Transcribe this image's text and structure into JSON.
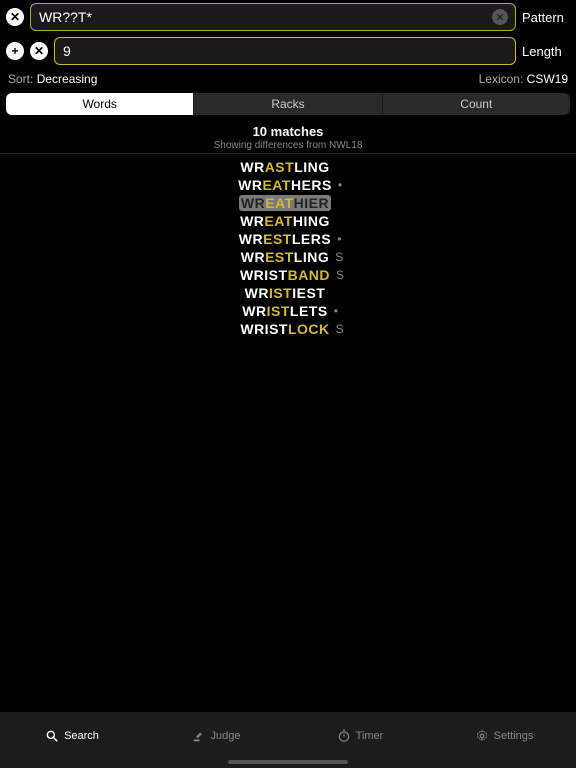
{
  "inputs": {
    "pattern_value": "WR??T*",
    "pattern_label": "Pattern",
    "length_value": "9",
    "length_label": "Length"
  },
  "sort": {
    "label": "Sort:",
    "value": "Decreasing"
  },
  "lexicon": {
    "label": "Lexicon:",
    "value": "CSW19"
  },
  "segments": {
    "words": "Words",
    "racks": "Racks",
    "count": "Count"
  },
  "header": {
    "matches": "10 matches",
    "sub": "Showing differences from NWL18"
  },
  "results": [
    {
      "parts": [
        {
          "t": "WR",
          "c": "w"
        },
        {
          "t": "AST",
          "c": "y"
        },
        {
          "t": "LING",
          "c": "w"
        }
      ],
      "after": "",
      "hl": false
    },
    {
      "parts": [
        {
          "t": "WR",
          "c": "w"
        },
        {
          "t": "EAT",
          "c": "y"
        },
        {
          "t": "HERS",
          "c": "w"
        }
      ],
      "after": "•",
      "hl": false
    },
    {
      "parts": [
        {
          "t": "WR",
          "c": "w"
        },
        {
          "t": "EAT",
          "c": "y"
        },
        {
          "t": "HIER",
          "c": "w"
        }
      ],
      "after": "",
      "hl": true
    },
    {
      "parts": [
        {
          "t": "WR",
          "c": "w"
        },
        {
          "t": "EAT",
          "c": "y"
        },
        {
          "t": "HING",
          "c": "w"
        }
      ],
      "after": "",
      "hl": false
    },
    {
      "parts": [
        {
          "t": "WR",
          "c": "w"
        },
        {
          "t": "EST",
          "c": "y"
        },
        {
          "t": "LERS",
          "c": "w"
        }
      ],
      "after": "•",
      "hl": false
    },
    {
      "parts": [
        {
          "t": "WR",
          "c": "w"
        },
        {
          "t": "EST",
          "c": "y"
        },
        {
          "t": "LING",
          "c": "w"
        }
      ],
      "after": "S",
      "hl": false
    },
    {
      "parts": [
        {
          "t": "WRIST",
          "c": "w"
        },
        {
          "t": "BAND",
          "c": "y"
        }
      ],
      "after": "S",
      "hl": false
    },
    {
      "parts": [
        {
          "t": "WR",
          "c": "w"
        },
        {
          "t": "IST",
          "c": "y"
        },
        {
          "t": "IEST",
          "c": "w"
        }
      ],
      "after": "",
      "hl": false
    },
    {
      "parts": [
        {
          "t": "WR",
          "c": "w"
        },
        {
          "t": "IST",
          "c": "y"
        },
        {
          "t": "LETS",
          "c": "w"
        }
      ],
      "after": "•",
      "hl": false
    },
    {
      "parts": [
        {
          "t": "WRIST",
          "c": "w"
        },
        {
          "t": "LOCK",
          "c": "y"
        }
      ],
      "after": "S",
      "hl": false
    }
  ],
  "tabs": {
    "search": "Search",
    "judge": "Judge",
    "timer": "Timer",
    "settings": "Settings"
  }
}
